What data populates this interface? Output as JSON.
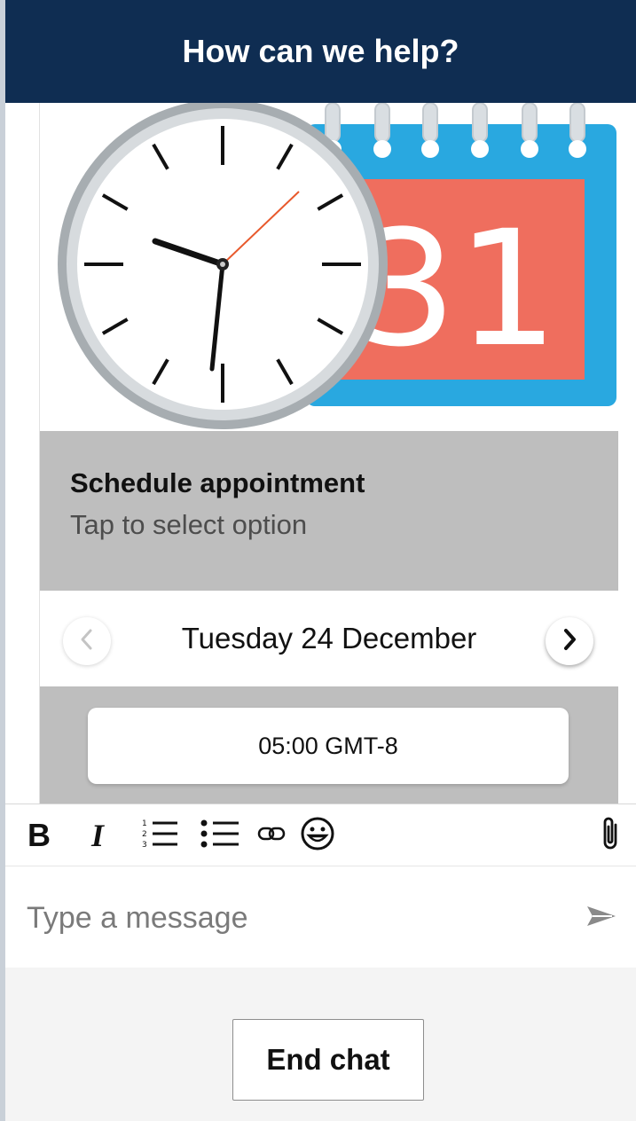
{
  "header": {
    "title": "How can we help?"
  },
  "card": {
    "image": {
      "icon": "clock-calendar-icon",
      "calendar_number": "31"
    },
    "title": "Schedule appointment",
    "subtitle": "Tap to select option",
    "date_picker": {
      "date_label": "Tuesday 24 December",
      "prev_icon": "chevron-left-icon",
      "next_icon": "chevron-right-icon"
    },
    "time_slots": [
      "05:00 GMT-8"
    ]
  },
  "toolbar": {
    "bold_label": "B",
    "italic_label": "I",
    "icons": [
      "numbered-list-icon",
      "bullet-list-icon",
      "link-icon",
      "emoji-icon",
      "paperclip-icon"
    ]
  },
  "composer": {
    "placeholder": "Type a message",
    "send_icon": "send-icon"
  },
  "footer": {
    "end_chat_label": "End chat"
  },
  "colors": {
    "header_bg": "#0f2d52",
    "card_band_bg": "#bebebe",
    "calendar_blue": "#29a8e0",
    "calendar_red": "#ef6e5e"
  }
}
